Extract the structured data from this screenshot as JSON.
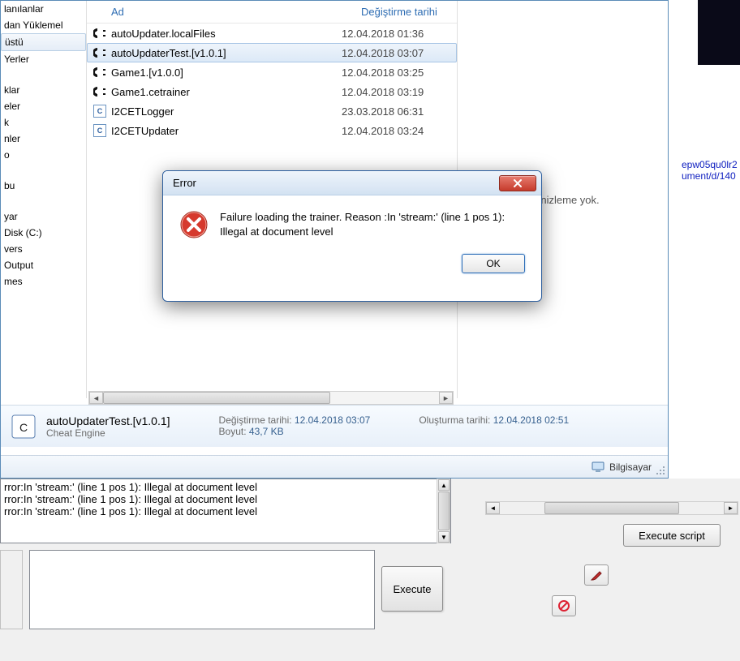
{
  "sidebar": {
    "items": [
      "lanılanlar",
      "dan Yüklemel",
      "üstü",
      "Yerler",
      "",
      "klar",
      "eler",
      "k",
      "nler",
      "o",
      "",
      "bu",
      "",
      "yar",
      "Disk (C:)",
      "vers",
      "Output",
      "mes"
    ]
  },
  "filelist": {
    "col_name": "Ad",
    "col_date": "Değiştirme tarihi",
    "rows": [
      {
        "icon": "ce",
        "name": "autoUpdater.localFiles",
        "date": "12.04.2018 01:36"
      },
      {
        "icon": "ce",
        "name": "autoUpdaterTest.[v1.0.1]",
        "date": "12.04.2018 03:07",
        "selected": true
      },
      {
        "icon": "ce",
        "name": "Game1.[v1.0.0]",
        "date": "12.04.2018 03:25"
      },
      {
        "icon": "ce",
        "name": "Game1.cetrainer",
        "date": "12.04.2018 03:19"
      },
      {
        "icon": "exe",
        "name": "I2CETLogger",
        "date": "23.03.2018 06:31"
      },
      {
        "icon": "exe",
        "name": "I2CETUpdater",
        "date": "12.04.2018 03:24"
      }
    ]
  },
  "preview": {
    "text": "ir önizleme yok."
  },
  "detail": {
    "filename": "autoUpdaterTest.[v1.0.1]",
    "filetype": "Cheat Engine",
    "mod_label": "Değiştirme tarihi:",
    "mod_value": "12.04.2018 03:07",
    "size_label": "Boyut:",
    "size_value": "43,7 KB",
    "create_label": "Oluşturma tarihi:",
    "create_value": "12.04.2018 02:51"
  },
  "statusbar": {
    "location": "Bilgisayar"
  },
  "error": {
    "title": "Error",
    "message": "Failure loading the trainer. Reason :In 'stream:' (line 1 pos 1): Illegal at document level",
    "ok": "OK"
  },
  "log": {
    "lines": [
      "rror:In 'stream:' (line 1 pos 1): Illegal at document level",
      "rror:In 'stream:' (line 1 pos 1): Illegal at document level",
      "rror:In 'stream:' (line 1 pos 1): Illegal at document level"
    ]
  },
  "buttons": {
    "execute": "Execute",
    "execute_script": "Execute script"
  },
  "frag": {
    "l1": "epw05qu0lr2",
    "l2": "ument/d/140"
  }
}
